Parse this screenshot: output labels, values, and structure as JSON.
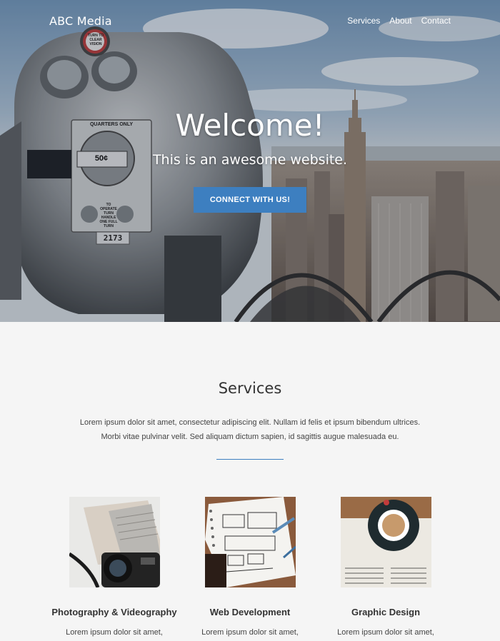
{
  "brand": "ABC Media",
  "nav": {
    "items": [
      "Services",
      "About",
      "Contact"
    ]
  },
  "hero": {
    "title": "Welcome!",
    "subtitle": "This is an awesome website.",
    "cta_label": "Connect with us!",
    "viewer_plate_top": "QUARTERS ONLY",
    "viewer_coin": "50¢",
    "viewer_plate_bottom": "TO OPERATE TURN HANDLE ONE FULL TURN",
    "viewer_number": "2173",
    "viewer_badge": "TURN TO CLEAR VISION"
  },
  "services": {
    "title": "Services",
    "description": "Lorem ipsum dolor sit amet, consectetur adipiscing elit. Nullam id felis et ipsum bibendum ultrices. Morbi vitae pulvinar velit. Sed aliquam dictum sapien, id sagittis augue malesuada eu.",
    "cards": [
      {
        "title": "Photography & Videography",
        "text": "Lorem ipsum dolor sit amet,",
        "image": "camera-laptop-photo"
      },
      {
        "title": "Web Development",
        "text": "Lorem ipsum dolor sit amet,",
        "image": "wireframe-sketch-photo"
      },
      {
        "title": "Graphic Design",
        "text": "Lorem ipsum dolor sit amet,",
        "image": "coffee-newspaper-photo"
      }
    ]
  },
  "colors": {
    "accent": "#3d7fc0",
    "page_bg": "#f5f5f5",
    "text": "#333333"
  }
}
